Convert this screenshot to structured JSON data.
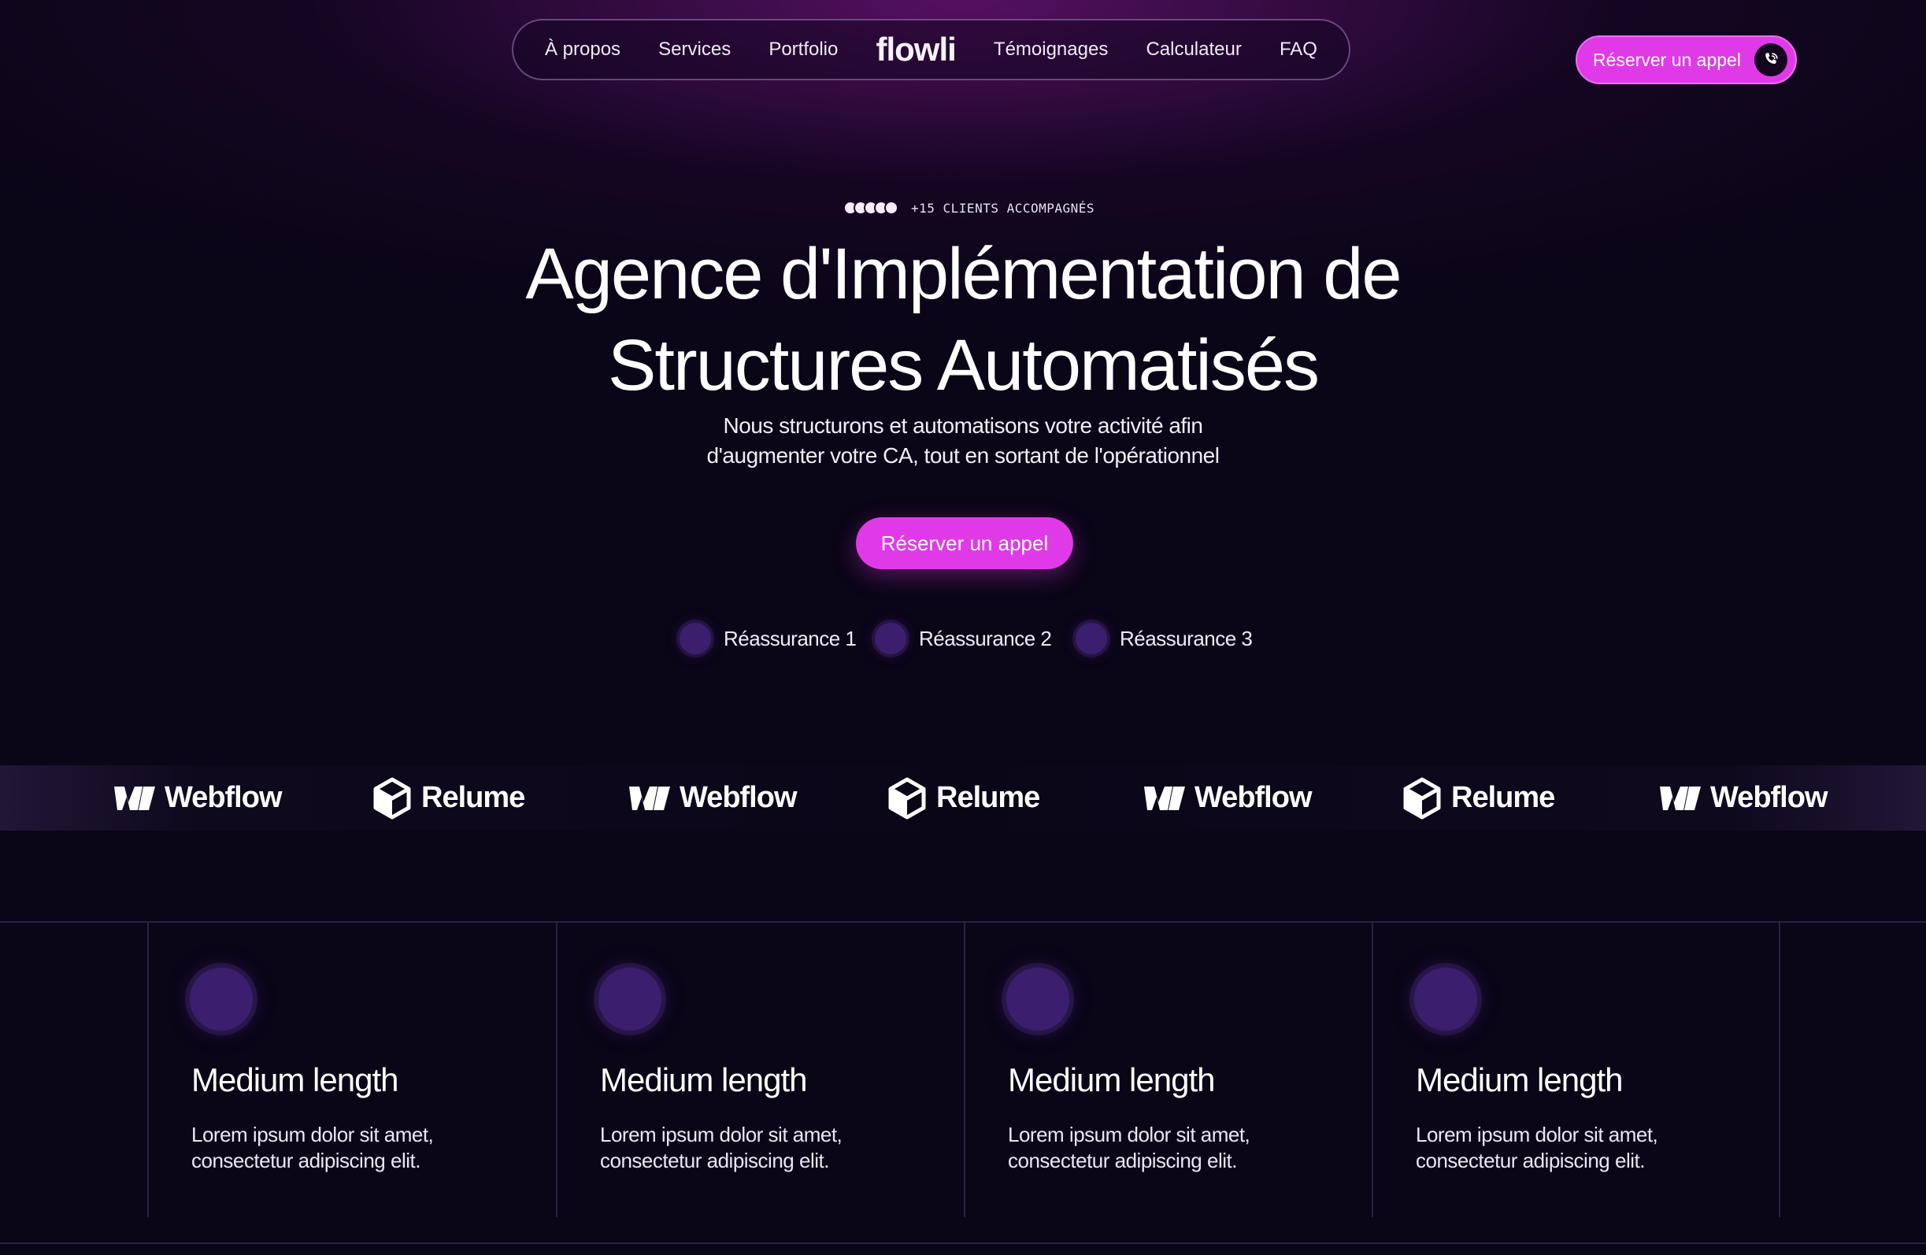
{
  "nav": {
    "links": [
      "À propos",
      "Services",
      "Portfolio",
      "Témoignages",
      "Calculateur",
      "FAQ"
    ],
    "logo": "flowli"
  },
  "header_cta": {
    "label": "Réserver un appel",
    "icon": "phone-icon"
  },
  "hero": {
    "badge": "+15 CLIENTS ACCOMPAGNÉS",
    "title_line1": "Agence d'Implémentation de",
    "title_line2": "Structures Automatisés",
    "subtitle_line1": "Nous structurons et automatisons votre activité afin",
    "subtitle_line2": "d'augmenter votre CA, tout en sortant de l'opérationnel",
    "cta": "Réserver un appel",
    "reassurance": [
      "Réassurance 1",
      "Réassurance 2",
      "Réassurance 3"
    ]
  },
  "logos": [
    {
      "name": "Webflow",
      "icon": "webflow-icon"
    },
    {
      "name": "Relume",
      "icon": "relume-icon"
    },
    {
      "name": "Webflow",
      "icon": "webflow-icon"
    },
    {
      "name": "Relume",
      "icon": "relume-icon"
    },
    {
      "name": "Webflow",
      "icon": "webflow-icon"
    },
    {
      "name": "Relume",
      "icon": "relume-icon"
    },
    {
      "name": "Webflow",
      "icon": "webflow-icon"
    }
  ],
  "features": [
    {
      "title": "Medium length",
      "desc_line1": "Lorem ipsum dolor sit amet,",
      "desc_line2": "consectetur adipiscing elit."
    },
    {
      "title": "Medium length",
      "desc_line1": "Lorem ipsum dolor sit amet,",
      "desc_line2": "consectetur adipiscing elit."
    },
    {
      "title": "Medium length",
      "desc_line1": "Lorem ipsum dolor sit amet,",
      "desc_line2": "consectetur adipiscing elit."
    },
    {
      "title": "Medium length",
      "desc_line1": "Lorem ipsum dolor sit amet,",
      "desc_line2": "consectetur adipiscing elit."
    }
  ],
  "colors": {
    "accent": "#e03ae8",
    "background": "#0a0517",
    "icon_circle": "#3b1f6e",
    "divider": "#2a2145"
  }
}
